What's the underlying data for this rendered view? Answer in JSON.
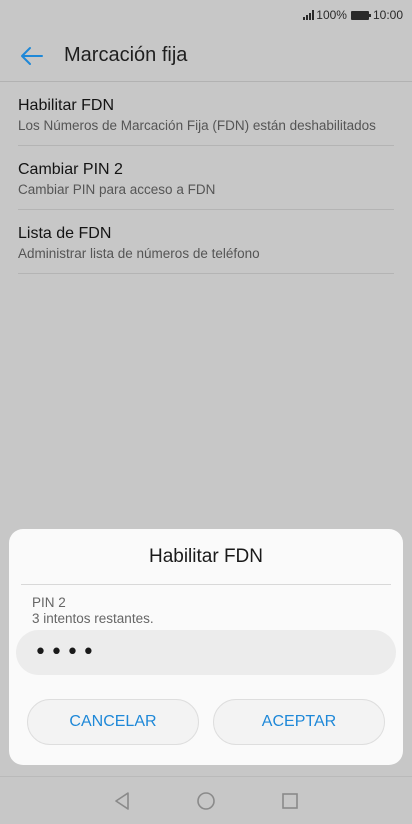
{
  "status_bar": {
    "battery_percent": "100%",
    "time": "10:00",
    "signal_icon": "signal-icon",
    "battery_icon": "battery-icon"
  },
  "app_bar": {
    "title": "Marcación fija",
    "back_icon": "arrow-left-icon",
    "accent_color": "#1e88d8"
  },
  "settings": {
    "items": [
      {
        "title": "Habilitar FDN",
        "subtitle": "Los Números de Marcación Fija (FDN) están deshabilitados"
      },
      {
        "title": "Cambiar PIN 2",
        "subtitle": "Cambiar PIN para acceso a FDN"
      },
      {
        "title": "Lista de FDN",
        "subtitle": "Administrar lista de números de teléfono"
      }
    ]
  },
  "dialog": {
    "title": "Habilitar FDN",
    "label_line1": "PIN 2",
    "label_line2": "3 intentos restantes.",
    "pin_value": "••••",
    "cancel_label": "CANCELAR",
    "accept_label": "ACEPTAR"
  },
  "nav_bar": {
    "back_icon": "triangle-back-icon",
    "home_icon": "circle-home-icon",
    "recents_icon": "square-recents-icon"
  }
}
